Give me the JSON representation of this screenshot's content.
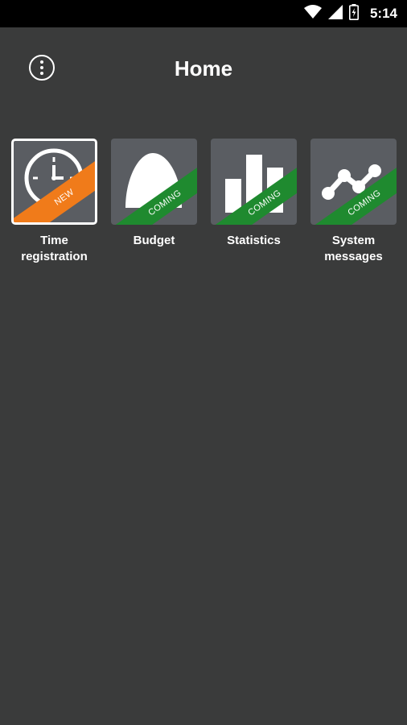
{
  "status_bar": {
    "time": "5:14",
    "icons": [
      "wifi-icon",
      "cellular-signal-icon",
      "battery-charging-icon"
    ]
  },
  "app_bar": {
    "title": "Home",
    "menu_icon": "more-vert-icon"
  },
  "tiles": [
    {
      "label": "Time registration",
      "badge": "NEW",
      "badge_color": "#f07b1a",
      "icon": "clock-icon",
      "selected": true
    },
    {
      "label": "Budget",
      "badge": "COMING",
      "badge_color": "#1f8a2f",
      "icon": "budget-icon",
      "selected": false
    },
    {
      "label": "Statistics",
      "badge": "COMING",
      "badge_color": "#1f8a2f",
      "icon": "bar-chart-icon",
      "selected": false
    },
    {
      "label": "System messages",
      "badge": "COMING",
      "badge_color": "#1f8a2f",
      "icon": "line-graph-icon",
      "selected": false
    }
  ],
  "colors": {
    "background": "#3a3b3b",
    "tile_background": "#5a5d62",
    "status_bar": "#000000"
  }
}
